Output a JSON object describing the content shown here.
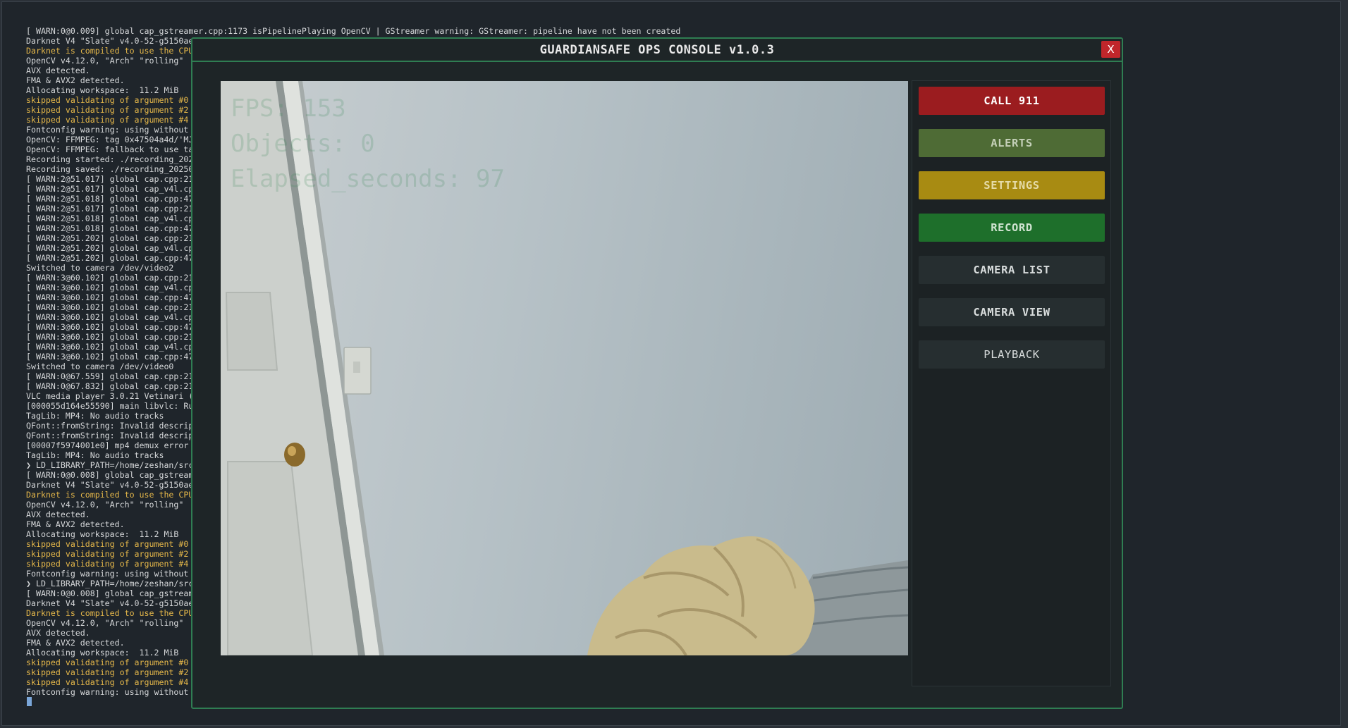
{
  "terminal": {
    "lines": [
      {
        "text": "[ WARN:0@0.009] global cap_gstreamer.cpp:1173 isPipelinePlaying OpenCV | GStreamer warning: GStreamer: pipeline have not been created",
        "style": "normal"
      },
      {
        "text": "Darknet V4 \"Slate\" v4.0-52-g5150ae",
        "style": "normal"
      },
      {
        "text": "Darknet is compiled to use the CPU",
        "style": "yellow"
      },
      {
        "text": "OpenCV v4.12.0, \"Arch\" \"rolling\"",
        "style": "normal"
      },
      {
        "text": "AVX detected.",
        "style": "normal"
      },
      {
        "text": "FMA & AVX2 detected.",
        "style": "normal"
      },
      {
        "text": "Allocating workspace:  11.2 MiB",
        "style": "normal"
      },
      {
        "text": "skipped validating of argument #0",
        "style": "yellow"
      },
      {
        "text": "skipped validating of argument #2",
        "style": "yellow"
      },
      {
        "text": "skipped validating of argument #4",
        "style": "yellow"
      },
      {
        "text": "Fontconfig warning: using without",
        "style": "normal"
      },
      {
        "text": "OpenCV: FFMPEG: tag 0x47504a4d/'MJ",
        "style": "normal"
      },
      {
        "text": "OpenCV: FFMPEG: fallback to use ta",
        "style": "normal"
      },
      {
        "text": "Recording started: ./recording_202",
        "style": "normal"
      },
      {
        "text": "Recording saved: ./recording_20250",
        "style": "normal"
      },
      {
        "text": "[ WARN:2@51.017] global cap.cpp:21",
        "style": "normal"
      },
      {
        "text": "[ WARN:2@51.017] global cap_v4l.cp",
        "style": "normal"
      },
      {
        "text": "[ WARN:2@51.018] global cap.cpp:47",
        "style": "normal"
      },
      {
        "text": "[ WARN:2@51.017] global cap.cpp:21",
        "style": "normal"
      },
      {
        "text": "[ WARN:2@51.018] global cap_v4l.cp",
        "style": "normal"
      },
      {
        "text": "[ WARN:2@51.018] global cap.cpp:47",
        "style": "normal"
      },
      {
        "text": "[ WARN:2@51.202] global cap.cpp:21",
        "style": "normal"
      },
      {
        "text": "[ WARN:2@51.202] global cap_v4l.cp",
        "style": "normal"
      },
      {
        "text": "[ WARN:2@51.202] global cap.cpp:47",
        "style": "normal"
      },
      {
        "text": "Switched to camera /dev/video2",
        "style": "normal"
      },
      {
        "text": "[ WARN:3@60.102] global cap.cpp:21",
        "style": "normal"
      },
      {
        "text": "[ WARN:3@60.102] global cap_v4l.cp",
        "style": "normal"
      },
      {
        "text": "[ WARN:3@60.102] global cap.cpp:47",
        "style": "normal"
      },
      {
        "text": "[ WARN:3@60.102] global cap.cpp:21",
        "style": "normal"
      },
      {
        "text": "[ WARN:3@60.102] global cap_v4l.cp",
        "style": "normal"
      },
      {
        "text": "[ WARN:3@60.102] global cap.cpp:47",
        "style": "normal"
      },
      {
        "text": "[ WARN:3@60.102] global cap.cpp:21",
        "style": "normal"
      },
      {
        "text": "[ WARN:3@60.102] global cap_v4l.cp",
        "style": "normal"
      },
      {
        "text": "[ WARN:3@60.102] global cap.cpp:47",
        "style": "normal"
      },
      {
        "text": "Switched to camera /dev/video0",
        "style": "normal"
      },
      {
        "text": "[ WARN:0@67.559] global cap.cpp:21",
        "style": "normal"
      },
      {
        "text": "[ WARN:0@67.832] global cap.cpp:21",
        "style": "normal"
      },
      {
        "text": "VLC media player 3.0.21 Vetinari (",
        "style": "normal"
      },
      {
        "text": "[000055d164e55590] main libvlc: Ru",
        "style": "normal"
      },
      {
        "text": "TagLib: MP4: No audio tracks",
        "style": "normal"
      },
      {
        "text": "QFont::fromString: Invalid descrip",
        "style": "normal"
      },
      {
        "text": "QFont::fromString: Invalid descrip",
        "style": "normal"
      },
      {
        "text": "[00007f5974001e0] mp4 demux error",
        "style": "normal"
      },
      {
        "text": "TagLib: MP4: No audio tracks",
        "style": "normal"
      },
      {
        "text": "❯ LD_LIBRARY_PATH=/home/zeshan/src",
        "style": "normal"
      },
      {
        "text": "[ WARN:0@0.008] global cap_gstream",
        "style": "normal"
      },
      {
        "text": "Darknet V4 \"Slate\" v4.0-52-g5150ae",
        "style": "normal"
      },
      {
        "text": "Darknet is compiled to use the CPU",
        "style": "yellow"
      },
      {
        "text": "OpenCV v4.12.0, \"Arch\" \"rolling\"",
        "style": "normal"
      },
      {
        "text": "AVX detected.",
        "style": "normal"
      },
      {
        "text": "FMA & AVX2 detected.",
        "style": "normal"
      },
      {
        "text": "Allocating workspace:  11.2 MiB",
        "style": "normal"
      },
      {
        "text": "skipped validating of argument #0",
        "style": "yellow"
      },
      {
        "text": "skipped validating of argument #2",
        "style": "yellow"
      },
      {
        "text": "skipped validating of argument #4",
        "style": "yellow"
      },
      {
        "text": "Fontconfig warning: using without",
        "style": "normal"
      },
      {
        "text": "❯ LD_LIBRARY_PATH=/home/zeshan/src",
        "style": "normal"
      },
      {
        "text": "[ WARN:0@0.008] global cap_gstream",
        "style": "normal"
      },
      {
        "text": "Darknet V4 \"Slate\" v4.0-52-g5150ae",
        "style": "normal"
      },
      {
        "text": "Darknet is compiled to use the CPU",
        "style": "yellow"
      },
      {
        "text": "OpenCV v4.12.0, \"Arch\" \"rolling\"",
        "style": "normal"
      },
      {
        "text": "AVX detected.",
        "style": "normal"
      },
      {
        "text": "FMA & AVX2 detected.",
        "style": "normal"
      },
      {
        "text": "Allocating workspace:  11.2 MiB",
        "style": "normal"
      },
      {
        "text": "skipped validating of argument #0",
        "style": "yellow"
      },
      {
        "text": "skipped validating of argument #2",
        "style": "yellow"
      },
      {
        "text": "skipped validating of argument #4",
        "style": "yellow"
      },
      {
        "text": "Fontconfig warning: using without",
        "style": "normal"
      }
    ]
  },
  "console": {
    "title": "GUARDIANSAFE OPS CONSOLE v1.0.3",
    "close_label": "X",
    "video_overlay": {
      "fps": "FPS: 153",
      "objects": "Objects: 0",
      "elapsed": "Elapsed_seconds: 97"
    },
    "buttons": [
      {
        "name": "call-911-button",
        "label": "CALL 911",
        "bg": "#9b1c1f",
        "fg": "#ffffff"
      },
      {
        "name": "alerts-button",
        "label": "ALERTS",
        "bg": "#4e6b35",
        "fg": "#c4d0b8"
      },
      {
        "name": "settings-button",
        "label": "SETTINGS",
        "bg": "#a88b12",
        "fg": "#e6dcaa"
      },
      {
        "name": "record-button",
        "label": "RECORD",
        "bg": "#1e6f2b",
        "fg": "#cfe3d0"
      },
      {
        "name": "camera-list-button",
        "label": "CAMERA LIST",
        "bg": "#262e30",
        "fg": "#d8dcdc"
      },
      {
        "name": "camera-view-button",
        "label": "CAMERA VIEW",
        "bg": "#262e30",
        "fg": "#d8dcdc"
      },
      {
        "name": "playback-button",
        "label": "PLAYBACK",
        "bg": "#262e30",
        "fg": "#d8dcdc"
      }
    ]
  }
}
